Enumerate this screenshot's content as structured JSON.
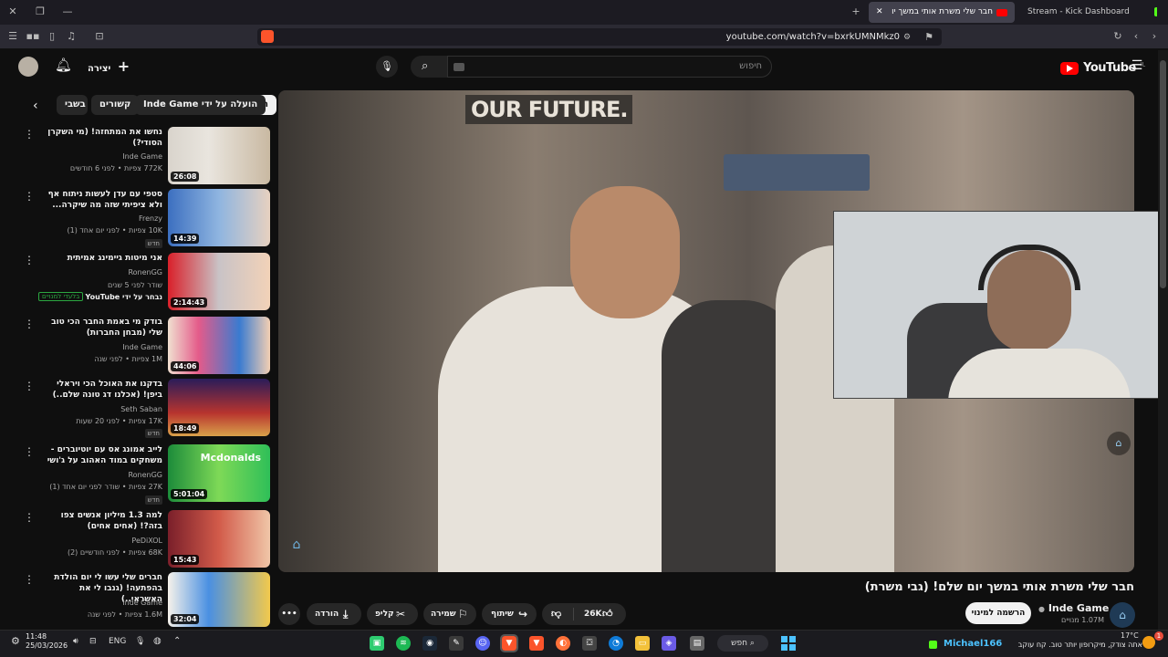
{
  "browser": {
    "tabs": [
      {
        "label": "חבר שלי משרת אותי במשך יו",
        "active": true
      },
      {
        "label": "Stream - Kick Dashboard",
        "active": false
      }
    ],
    "url": "youtube.com/watch?v=bxrkUMNMkz0"
  },
  "header": {
    "logo": "YouTube",
    "logo_superscript": "IL",
    "search_placeholder": "חיפוש",
    "create_label": "יצירה"
  },
  "chips": [
    {
      "label": "הכול",
      "selected": true
    },
    {
      "label": "הועלה על ידי Inde Game",
      "selected": false
    },
    {
      "label": "קשורים",
      "selected": false
    },
    {
      "label": "בשבי",
      "selected": false
    }
  ],
  "recommended": [
    {
      "title": "נחשו את המתחזה! (מי השקרן הסודי?)",
      "channel": "Inde Game",
      "meta": "772K צפיות • לפני 6 חודשים",
      "duration": "26:08",
      "badge": ""
    },
    {
      "title": "סטפי עם עדן לעשות ניתוח אף ולא ציפיתי שזה מה שיקרה...",
      "channel": "Frenzy",
      "meta": "10K צפיות • לפני יום אחד (1)",
      "duration": "14:39",
      "badge": "חדש"
    },
    {
      "title": "אני מיטות גיימינג אמיתית",
      "channel": "RonenGG",
      "meta": "שודר לפני 5 שנים",
      "duration": "2:14:43",
      "badge": "",
      "extra": "נבחר על ידי YouTube",
      "extra2": "בלעדי למנויים"
    },
    {
      "title": "בודק מי באמת החבר הכי טוב שלי (מבחן החברות)",
      "channel": "Inde Game",
      "meta": "1M צפיות • לפני שנה",
      "duration": "44:06",
      "badge": ""
    },
    {
      "title": "בדקנו את האוכל הכי ויראלי ביפן! (אכלנו דג טונה שלם..)",
      "channel": "Seth Saban",
      "meta": "17K צפיות • לפני 20 שעות",
      "duration": "18:49",
      "badge": "חדש"
    },
    {
      "title": "לייב אמונג אס עם יוטיוברים - משחקים במוד האהוב על ג'ושי",
      "channel": "RonenGG",
      "meta": "27K צפיות • שודר לפני יום אחד (1)",
      "duration": "5:01:04",
      "badge": "חדש"
    },
    {
      "title": "למה 1.3 מיליון אנשים צפו בזה?! (אחים אחים)",
      "channel": "PeDiXOL",
      "meta": "68K צפיות • לפני חודשיים (2)",
      "duration": "15:43",
      "badge": ""
    },
    {
      "title": "חברים שלי עשו לי יום הולדת בהפתעה! (גנבו לי את האשראי..)",
      "channel": "Inde Game",
      "meta": "1.6M צפיות • לפני שנה",
      "duration": "32:04",
      "badge": ""
    }
  ],
  "video": {
    "title": "חבר שלי משרת אותי במשך יום שלם! (גבי משרת)",
    "channel": "Inde Game",
    "subscribers": "1.07M מנויים",
    "subscribe_label": "הרשמה למינוי",
    "likes": "26K",
    "share_label": "שיתוף",
    "save_label": "שמירה",
    "clip_label": "קליפ",
    "download_label": "הורדה",
    "more_label": "•••",
    "scene_text": "OUR FUTURE."
  },
  "taskbar": {
    "time": "11:48",
    "date": "25/03/2026",
    "lang": "ENG",
    "search_label": "חפש",
    "weather": "17°C",
    "ticker": "אתה צודק, מיקרופון יותר טוב. קח עוקב",
    "ticker_user": "Michael166",
    "notification_count": "1"
  },
  "colors": {
    "yt_red": "#ff0000",
    "bg": "#0f0f0f",
    "chip_bg": "#272727",
    "kick_green": "#53fc18"
  }
}
